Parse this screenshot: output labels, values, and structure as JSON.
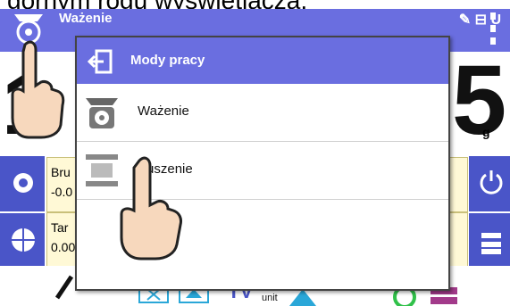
{
  "caption": "górnym rogu wyświetlacza;",
  "header": {
    "title": "Ważenie",
    "status_icons": "✎ ⊟ U"
  },
  "display": {
    "digit_left": "1",
    "digit_right": "5",
    "unit": "g"
  },
  "info_rows": [
    {
      "label": "Bru",
      "value": "-0.0"
    },
    {
      "label": "Tar",
      "value": "0.00"
    }
  ],
  "bottom_bar": {
    "unit_label": "unit"
  },
  "popup": {
    "title": "Mody pracy",
    "items": [
      {
        "label": "Ważenie",
        "icon": "scale-icon"
      },
      {
        "label": "Suszenie",
        "icon": "drying-icon"
      }
    ]
  },
  "colors": {
    "accent": "#6a6ee0",
    "side": "#4a55c8",
    "info_bg": "#fff9d6"
  }
}
